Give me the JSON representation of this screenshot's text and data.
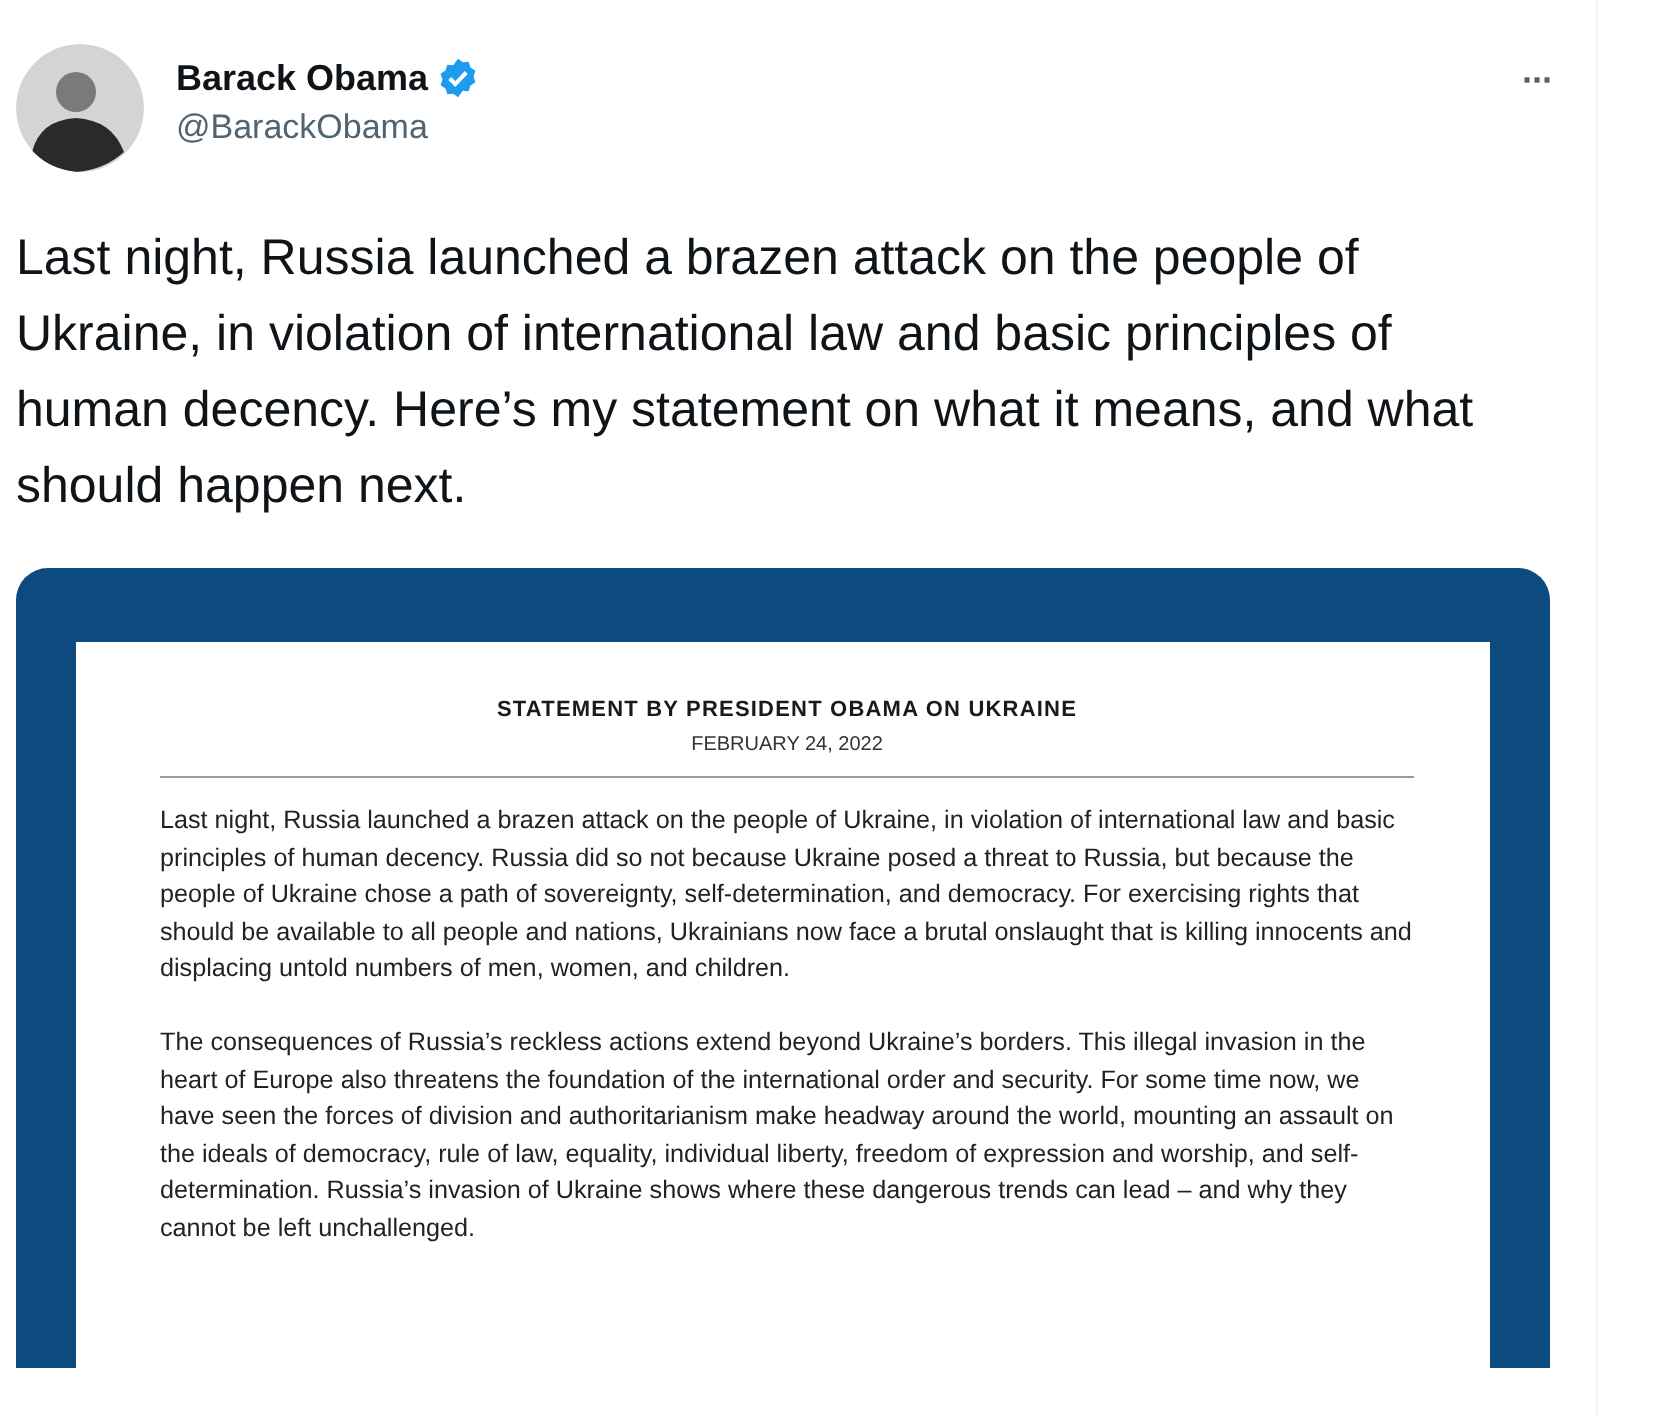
{
  "author": {
    "name": "Barack Obama",
    "verified": true,
    "handle": "@BarackObama"
  },
  "more_menu": "···",
  "tweet_text": "Last night, Russia launched a brazen attack on the people of Ukraine, in violation of international law and basic principles of human decency. Here’s my statement on what it means, and what should happen next.",
  "attachment": {
    "title": "STATEMENT BY PRESIDENT OBAMA ON UKRAINE",
    "date": "FEBRUARY 24, 2022",
    "paragraphs": [
      "Last night, Russia launched a brazen attack on the people of Ukraine, in violation of international law and basic principles of human decency. Russia did so not because Ukraine posed a threat to Russia, but because the people of Ukraine chose a path of sovereignty, self-determination, and democracy. For exercising rights that should be available to all people and nations, Ukrainians now face a brutal onslaught that is killing innocents and displacing untold numbers of men, women, and children.",
      "The consequences of Russia’s reckless actions extend beyond Ukraine’s borders. This illegal invasion in the heart of Europe also threatens the foundation of the international order and security. For some time now, we have seen the forces of division and authoritarianism make headway around the world, mounting an assault on the ideals of democracy, rule of law, equality, individual liberty, freedom of expression and worship, and self-determination. Russia’s invasion of Ukraine shows where these dangerous trends can lead – and why they cannot be left unchallenged."
    ]
  }
}
